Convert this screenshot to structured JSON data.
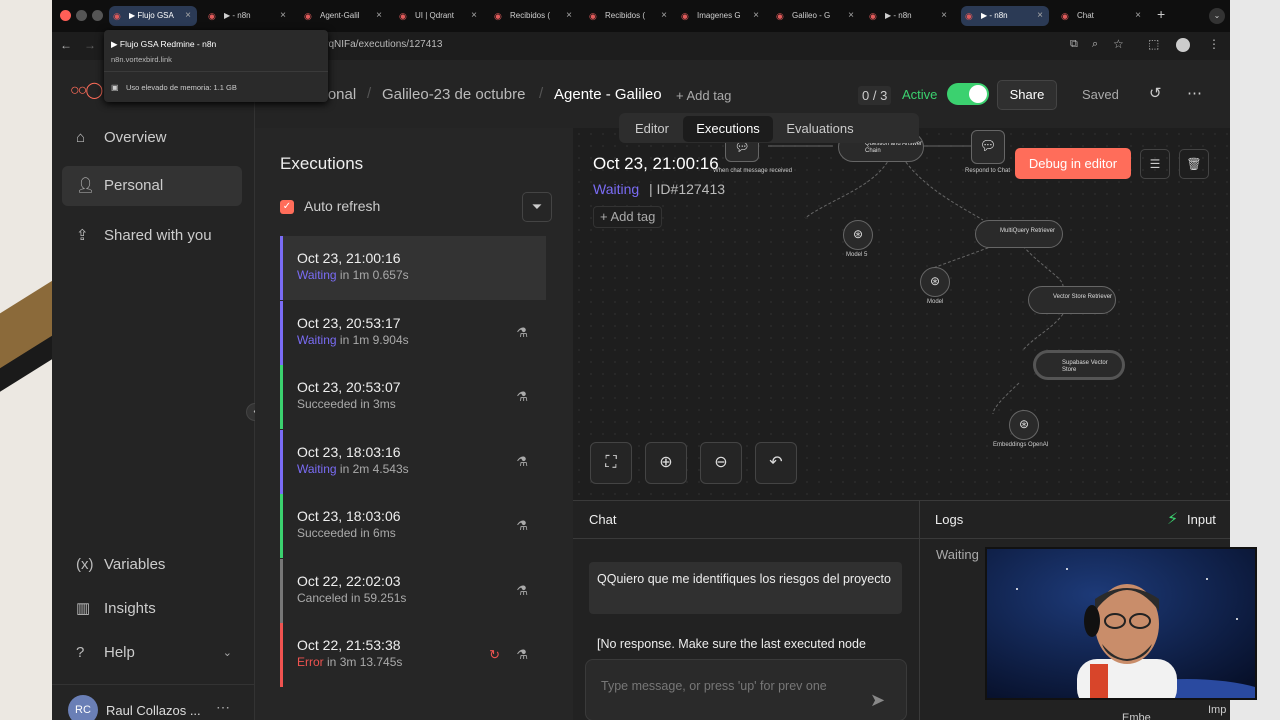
{
  "browser": {
    "tabs": [
      {
        "label": "▶ Flujo GSA",
        "active": true
      },
      {
        "label": "▶ - n8n"
      },
      {
        "label": "Agent-Galil"
      },
      {
        "label": "UI | Qdrant"
      },
      {
        "label": "Recibidos ("
      },
      {
        "label": "Recibidos ("
      },
      {
        "label": "Imagenes G"
      },
      {
        "label": "Galileo - G"
      },
      {
        "label": "▶ - n8n"
      },
      {
        "label": "▶ - n8n",
        "active2": true
      },
      {
        "label": "Chat"
      }
    ],
    "url": "CNNQtK6tivqNIFa/executions/127413",
    "tooltip": {
      "title": "▶ Flujo GSA Redmine - n8n",
      "domain": "n8n.vortexbird.link",
      "memory": "Uso elevado de memoria: 1.1 GB"
    }
  },
  "sidebar": {
    "items": [
      {
        "label": "Overview",
        "icon": "home-icon"
      },
      {
        "label": "Personal",
        "icon": "user-icon",
        "selected": true
      },
      {
        "label": "Shared with you",
        "icon": "share-icon"
      }
    ],
    "bottom": [
      {
        "label": "Variables",
        "icon": "variables-icon"
      },
      {
        "label": "Insights",
        "icon": "chart-icon"
      },
      {
        "label": "Help",
        "icon": "help-icon"
      }
    ],
    "user": {
      "initials": "RC",
      "name": "Raul Collazos ..."
    }
  },
  "header": {
    "breadcrumb_owner": "Personal",
    "breadcrumb_folder": "Galileo-23 de octubre",
    "workflow_name": "Agente - Galileo",
    "add_tag": "+ Add tag",
    "counter": "0 / 3",
    "active_label": "Active",
    "share_label": "Share",
    "saved_label": "Saved"
  },
  "center_tabs": [
    "Editor",
    "Executions",
    "Evaluations"
  ],
  "executions": {
    "title": "Executions",
    "auto_refresh": "Auto refresh",
    "items": [
      {
        "date": "Oct 23, 21:00:16",
        "status": "Waiting",
        "duration": "in 1m 0.657s"
      },
      {
        "date": "Oct 23, 20:53:17",
        "status": "Waiting",
        "duration": "in 1m 9.904s"
      },
      {
        "date": "Oct 23, 20:53:07",
        "status": "Succeeded in 3ms",
        "duration": ""
      },
      {
        "date": "Oct 23, 18:03:16",
        "status": "Waiting",
        "duration": "in 2m 4.543s"
      },
      {
        "date": "Oct 23, 18:03:06",
        "status": "Succeeded in 6ms",
        "duration": ""
      },
      {
        "date": "Oct 22, 22:02:03",
        "status": "Canceled in 59.251s",
        "duration": ""
      },
      {
        "date": "Oct 22, 21:53:38",
        "status": "Error",
        "duration": "in 3m 13.745s"
      }
    ]
  },
  "execution_detail": {
    "date": "Oct 23, 21:00:16",
    "status": "Waiting",
    "id": "| ID#127413",
    "add_tag": "Add tag",
    "debug_button": "Debug in editor"
  },
  "nodes": {
    "chat_trigger": "When chat message received",
    "qa_chain": "Question and Answer Chain",
    "respond": "Respond to Chat",
    "model5": "Model 5",
    "multiquery": "MultiQuery Retriever",
    "model": "Model",
    "vector_retriever": "Vector Store Retriever",
    "supabase": "Supabase Vector Store",
    "embeddings": "Embeddings OpenAI"
  },
  "bottom_panel": {
    "chat_title": "Chat",
    "logs_title": "Logs",
    "input_label": "Input",
    "logs_status": "Waiting",
    "user_message": "QQuiero que me identifiques los riesgos del proyecto",
    "bot_message": "[No response. Make sure the last executed node",
    "input_placeholder": "Type message, or press 'up' for prev one",
    "embeddings_partial": "Embe",
    "imp_partial": "Imp"
  },
  "colors": {
    "accent": "#ff6d5a",
    "active_green": "#3bd16f",
    "waiting_purple": "#7a6cf5",
    "error_red": "#ef5350"
  }
}
